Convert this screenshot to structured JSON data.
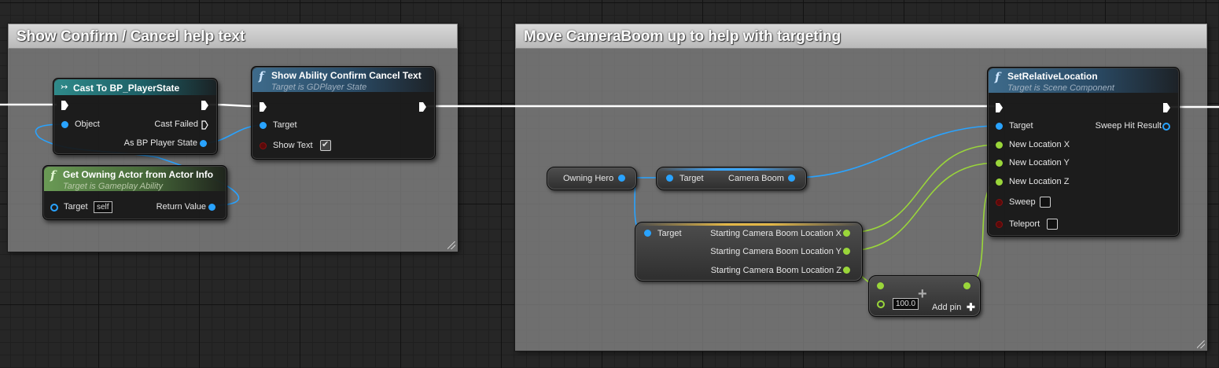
{
  "comments": [
    {
      "title": "Show Confirm / Cancel help text"
    },
    {
      "title": "Move CameraBoom up to help with targeting"
    }
  ],
  "nodes": {
    "cast": {
      "title": "Cast To BP_PlayerState",
      "object_label": "Object",
      "cast_failed_label": "Cast Failed",
      "as_label": "As BP Player State"
    },
    "show_text": {
      "title": "Show Ability Confirm Cancel Text",
      "subtitle": "Target is GDPlayer State",
      "target_label": "Target",
      "show_text_label": "Show Text",
      "show_text_checked": true
    },
    "get_owning": {
      "title": "Get Owning Actor from Actor Info",
      "subtitle": "Target is Gameplay Ability",
      "target_label": "Target",
      "target_default": "self",
      "return_label": "Return Value"
    },
    "owning_hero": {
      "label": "Owning Hero"
    },
    "camera_boom": {
      "target_label": "Target",
      "output_label": "Camera Boom"
    },
    "starting_loc": {
      "target_label": "Target",
      "x_label": "Starting Camera Boom Location X",
      "y_label": "Starting Camera Boom Location Y",
      "z_label": "Starting Camera Boom Location Z"
    },
    "add": {
      "value": "100.0",
      "add_pin_label": "Add pin"
    },
    "set_rel": {
      "title": "SetRelativeLocation",
      "subtitle": "Target is Scene Component",
      "target_label": "Target",
      "sweep_hit_label": "Sweep Hit Result",
      "new_x_label": "New Location X",
      "new_y_label": "New Location Y",
      "new_z_label": "New Location Z",
      "sweep_label": "Sweep",
      "teleport_label": "Teleport",
      "sweep_checked": false,
      "teleport_checked": false
    }
  },
  "colors": {
    "exec_wire": "#ffffff",
    "object_wire": "#29a3ff",
    "float_wire": "#9ad63a"
  }
}
